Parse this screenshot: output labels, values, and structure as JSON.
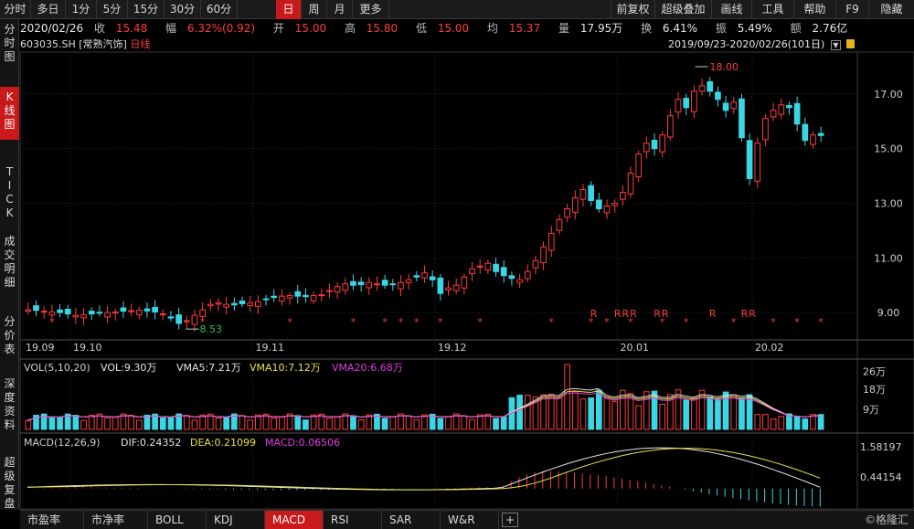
{
  "toolbar": {
    "periods": [
      "分时",
      "多日",
      "1分",
      "5分",
      "15分",
      "30分",
      "60分",
      "日",
      "周",
      "月",
      "更多"
    ],
    "active": "日",
    "right": [
      "前复权",
      "超级叠加",
      "画线",
      "工具",
      "帮助",
      "F9",
      "隐藏"
    ]
  },
  "quote": {
    "date": "2020/02/26",
    "close_label": "收",
    "close": "15.48",
    "change_label": "幅",
    "change": "6.32%(0.92)",
    "open_label": "开",
    "open": "15.00",
    "high_label": "高",
    "high": "15.80",
    "low_label": "低",
    "low": "15.00",
    "avg_label": "均",
    "avg": "15.37",
    "volume_label": "量",
    "volume": "17.95万",
    "turnover_label": "换",
    "turnover": "6.41%",
    "amplitude_label": "振",
    "amplitude": "5.49%",
    "amount_label": "额",
    "amount": "2.76亿"
  },
  "left_tabs": [
    {
      "label": "分时图",
      "active": false
    },
    {
      "label": "K线图",
      "active": true
    },
    {
      "label": "TICK",
      "active": false
    },
    {
      "label": "成交明细",
      "active": false
    },
    {
      "label": "分价表",
      "active": false
    },
    {
      "label": "深度资料",
      "active": false
    },
    {
      "label": "超级复盘",
      "active": false
    }
  ],
  "chart_header": {
    "code": "603035.SH",
    "name": "[常熟汽饰]",
    "period": "日线",
    "range": "2019/09/23-2020/02/26(101日)"
  },
  "chart_data": [
    {
      "type": "candlestick",
      "title": "603035.SH [常熟汽饰] 日线",
      "x_tick_labels": [
        "19.09",
        "19.10",
        "19.11",
        "19.12",
        "20.01",
        "20.02"
      ],
      "y_tick_labels": [
        "9.00",
        "11.00",
        "13.00",
        "15.00",
        "17.00"
      ],
      "ylim": [
        8.0,
        18.5
      ],
      "annotations": [
        {
          "label": "18.00",
          "value": 18.0,
          "kind": "high"
        },
        {
          "label": "8.53",
          "value": 8.53,
          "kind": "low"
        }
      ],
      "marker_symbols": [
        "*",
        "R"
      ],
      "ohlc_approx_close": [
        9.1,
        9.08,
        9.05,
        9.02,
        9.0,
        8.95,
        8.9,
        8.92,
        8.95,
        8.98,
        9.0,
        9.02,
        9.05,
        9.07,
        9.08,
        9.06,
        9.02,
        8.95,
        8.8,
        8.6,
        8.7,
        8.9,
        9.1,
        9.3,
        9.35,
        9.3,
        9.28,
        9.32,
        9.35,
        9.4,
        9.5,
        9.55,
        9.6,
        9.62,
        9.6,
        9.58,
        9.62,
        9.65,
        9.8,
        9.95,
        10.05,
        10.0,
        10.02,
        10.1,
        10.05,
        10.0,
        10.02,
        10.1,
        10.2,
        10.3,
        10.45,
        10.2,
        9.7,
        9.9,
        10.0,
        10.3,
        10.6,
        10.7,
        10.8,
        10.5,
        10.35,
        10.25,
        10.2,
        10.5,
        10.9,
        11.4,
        11.9,
        12.4,
        12.8,
        13.2,
        13.5,
        13.1,
        12.8,
        12.9,
        13.0,
        13.4,
        14.1,
        14.8,
        15.2,
        15.0,
        15.5,
        16.2,
        16.8,
        16.5,
        17.1,
        17.3,
        17.1,
        16.8,
        16.4,
        16.7,
        15.4,
        13.9,
        15.2,
        16.1,
        16.4,
        16.6,
        16.5,
        15.9,
        15.3,
        15.5,
        15.48
      ],
      "y_label": "",
      "x_label": ""
    },
    {
      "type": "bar",
      "title": "VOL(5,10,20)",
      "series": [
        {
          "name": "VOL",
          "value_label": "9.30万"
        },
        {
          "name": "VMA5",
          "value_label": "7.21万"
        },
        {
          "name": "VMA10",
          "value_label": "7.12万"
        },
        {
          "name": "VMA20",
          "value_label": "6.68万"
        }
      ],
      "y_tick_labels": [
        "26万",
        "18万",
        "9万"
      ],
      "ylim": [
        0,
        30
      ]
    },
    {
      "type": "line",
      "title": "MACD(12,26,9)",
      "series": [
        {
          "name": "DIF",
          "value_label": "0.24352"
        },
        {
          "name": "DEA",
          "value_label": "0.21099"
        },
        {
          "name": "MACD",
          "value_label": "0.06506"
        }
      ],
      "y_tick_labels": [
        "1.58197",
        "0.44154"
      ],
      "ylim": [
        -0.6,
        1.9
      ]
    }
  ],
  "volume_legend": {
    "title": "VOL(5,10,20)",
    "vol": "VOL:9.30万",
    "vma5": "VMA5:7.21万",
    "vma10": "VMA10:7.12万",
    "vma20": "VMA20:6.68万"
  },
  "macd_legend": {
    "title": "MACD(12,26,9)",
    "dif": "DIF:0.24352",
    "dea": "DEA:0.21099",
    "macd": "MACD:0.06506"
  },
  "bottom_tabs": [
    "市盈率",
    "市净率",
    "BOLL",
    "KDJ",
    "MACD",
    "RSI",
    "SAR",
    "W&R",
    "+"
  ],
  "bottom_active": "MACD",
  "watermark": "©格隆汇",
  "colors": {
    "up": "#ff3b3b",
    "down": "#39d6e6",
    "accent": "#c8191b"
  }
}
